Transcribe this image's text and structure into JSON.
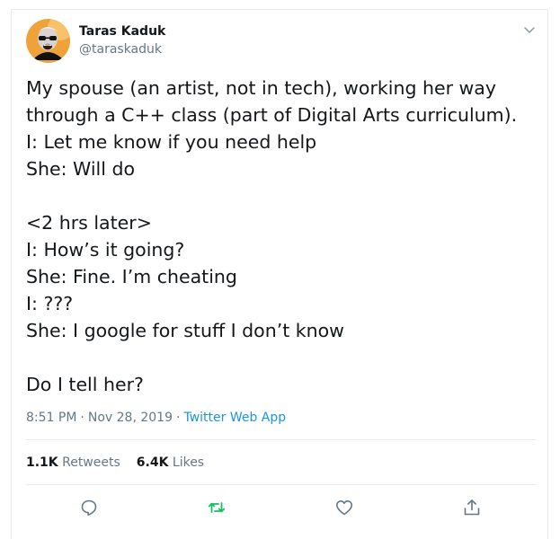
{
  "tweet": {
    "author": {
      "name": "Taras Kaduk",
      "handle": "@taraskaduk"
    },
    "lines": [
      "My spouse (an artist, not in tech), working her way",
      "through a C++ class (part of Digital Arts curriculum).",
      "I: Let me know if you need help",
      "She: Will do",
      "",
      "<2 hrs later>",
      "I: How’s it going?",
      "She: Fine. I’m cheating",
      "I: ???",
      "She: I google for stuff I don’t know",
      "",
      "Do I tell her?"
    ],
    "meta": {
      "time": "8:51 PM",
      "date": "Nov 28, 2019",
      "separator": "·",
      "source": "Twitter Web App"
    },
    "stats": {
      "retweets_count": "1.1K",
      "retweets_label": "Retweets",
      "likes_count": "6.4K",
      "likes_label": "Likes"
    },
    "icons": {
      "caret": "chevron-down-icon",
      "reply": "reply-icon",
      "retweet": "retweet-icon",
      "like": "heart-icon",
      "share": "share-icon"
    },
    "colors": {
      "text": "#14171a",
      "secondary": "#657786",
      "link": "#1b95e0",
      "retweet_green": "#17bf63",
      "border": "#e6ecf0"
    }
  }
}
